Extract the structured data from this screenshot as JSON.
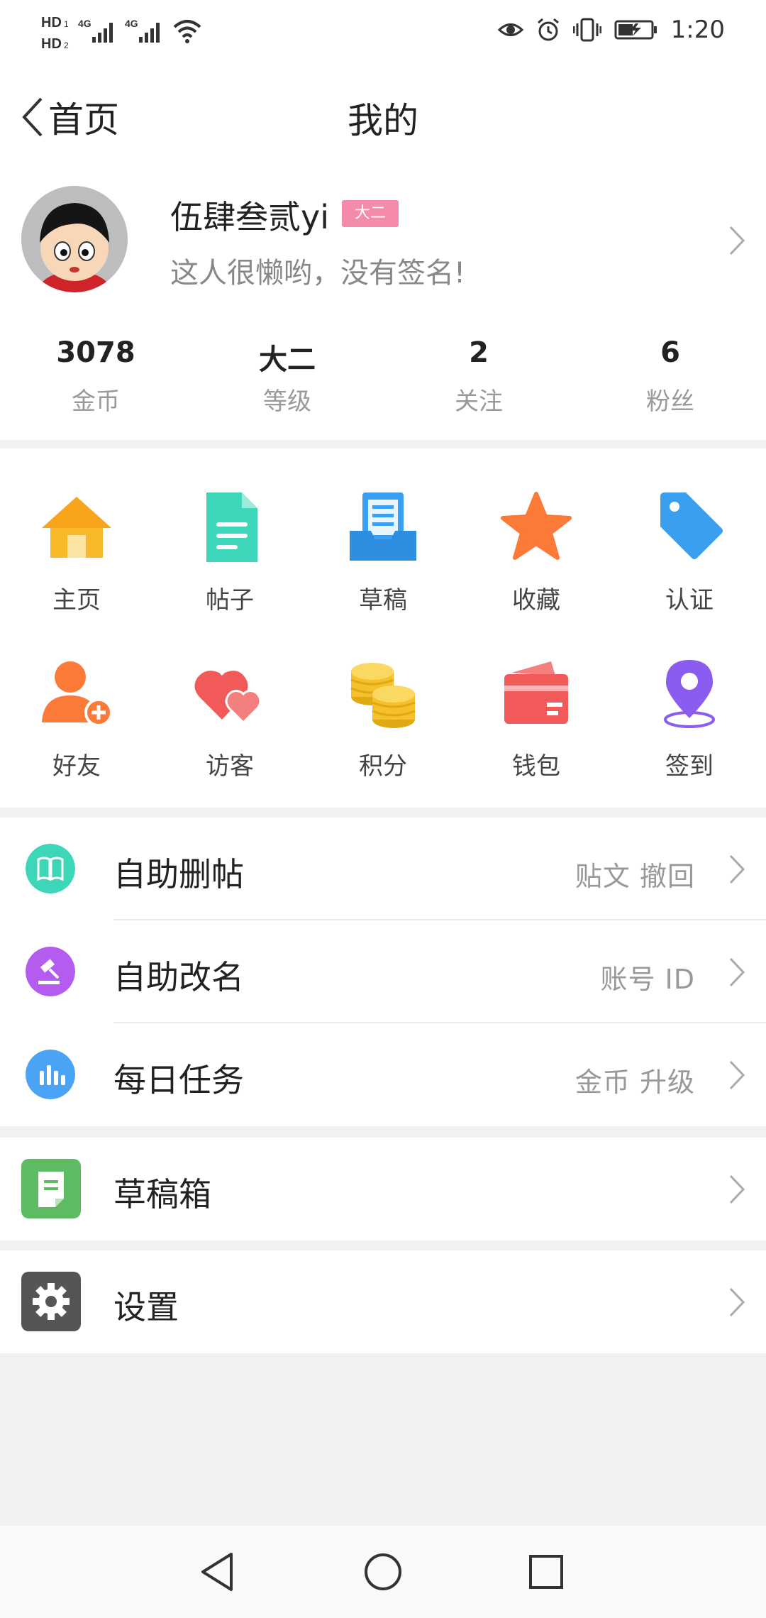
{
  "status_bar": {
    "time": "1:20",
    "sim1": "HD 1",
    "sim2": "HD 2",
    "network1": "4G",
    "network2": "4G",
    "icons": [
      "eye-icon",
      "alarm-icon",
      "vibrate-icon",
      "battery-charging-icon"
    ]
  },
  "header": {
    "back_label": "首页",
    "title": "我的"
  },
  "profile": {
    "name": "伍肆叁贰yi",
    "level_badge": "大二",
    "signature": "这人很懒哟，没有签名!"
  },
  "stats": [
    {
      "value": "3078",
      "label": "金币"
    },
    {
      "value": "大二",
      "label": "等级"
    },
    {
      "value": "2",
      "label": "关注"
    },
    {
      "value": "6",
      "label": "粉丝"
    }
  ],
  "grid": [
    {
      "label": "主页",
      "icon": "home-icon",
      "color": "#f7b82a"
    },
    {
      "label": "帖子",
      "icon": "document-icon",
      "color": "#3ed6b8"
    },
    {
      "label": "草稿",
      "icon": "draft-tray-icon",
      "color": "#3a9ff0"
    },
    {
      "label": "收藏",
      "icon": "star-icon",
      "color": "#fb7a38"
    },
    {
      "label": "认证",
      "icon": "tag-icon",
      "color": "#3a9ff0"
    },
    {
      "label": "好友",
      "icon": "add-friend-icon",
      "color": "#fb7a38"
    },
    {
      "label": "访客",
      "icon": "hearts-icon",
      "color": "#f25a5a"
    },
    {
      "label": "积分",
      "icon": "coins-icon",
      "color": "#f5c02b"
    },
    {
      "label": "钱包",
      "icon": "wallet-icon",
      "color": "#f25a5a"
    },
    {
      "label": "签到",
      "icon": "location-pin-icon",
      "color": "#8a5cf0"
    }
  ],
  "list_group1": [
    {
      "title": "自助删帖",
      "hint": "贴文  撤回",
      "icon": "book-icon",
      "color": "#3ed6b8"
    },
    {
      "title": "自助改名",
      "hint": "账号  ID",
      "icon": "gavel-icon",
      "color": "#b45cf0"
    },
    {
      "title": "每日任务",
      "hint": "金币  升级",
      "icon": "bar-chart-icon",
      "color": "#4aa3f5"
    }
  ],
  "list_drafts": {
    "title": "草稿箱",
    "icon": "note-icon",
    "color": "#5dbb63"
  },
  "list_settings": {
    "title": "设置",
    "icon": "gear-icon",
    "color": "#555555"
  },
  "nav": [
    "back-nav-icon",
    "home-nav-icon",
    "recents-nav-icon"
  ]
}
